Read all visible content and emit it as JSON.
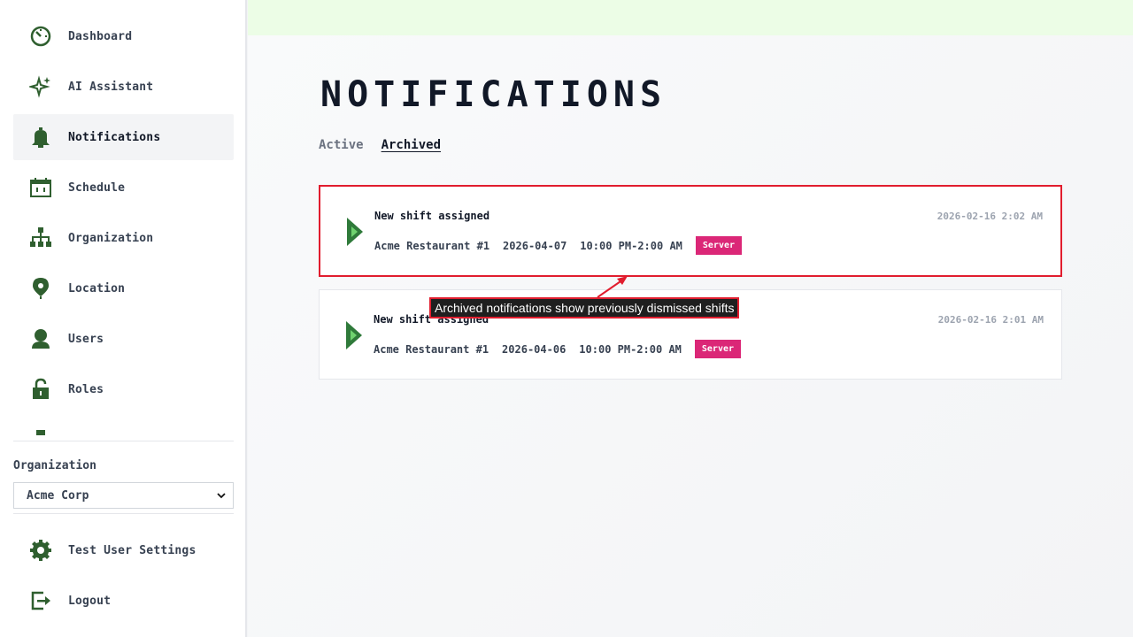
{
  "sidebar": {
    "items": [
      {
        "label": "Dashboard",
        "icon": "dashboard-icon"
      },
      {
        "label": "AI Assistant",
        "icon": "sparkle-icon"
      },
      {
        "label": "Notifications",
        "icon": "bell-icon",
        "active": true
      },
      {
        "label": "Schedule",
        "icon": "calendar-icon"
      },
      {
        "label": "Organization",
        "icon": "org-chart-icon"
      },
      {
        "label": "Location",
        "icon": "map-pin-icon"
      },
      {
        "label": "Users",
        "icon": "user-icon"
      },
      {
        "label": "Roles",
        "icon": "lock-icon"
      }
    ],
    "organization_label": "Organization",
    "organization_selected": "Acme Corp",
    "bottom_items": [
      {
        "label": "Test User Settings",
        "icon": "gear-icon"
      },
      {
        "label": "Logout",
        "icon": "logout-icon"
      }
    ]
  },
  "main": {
    "title": "NOTIFICATIONS",
    "tabs": [
      {
        "label": "Active",
        "selected": false
      },
      {
        "label": "Archived",
        "selected": true
      }
    ],
    "notifications": [
      {
        "title": "New shift assigned",
        "location": "Acme Restaurant #1",
        "date": "2026-04-07",
        "time_range": "10:00 PM-2:00 AM",
        "role": "Server",
        "timestamp": "2026-02-16 2:02 AM"
      },
      {
        "title": "New shift assigned",
        "location": "Acme Restaurant #1",
        "date": "2026-04-06",
        "time_range": "10:00 PM-2:00 AM",
        "role": "Server",
        "timestamp": "2026-02-16 2:01 AM"
      }
    ]
  },
  "annotation": {
    "text": "Archived notifications show previously dismissed shifts"
  },
  "colors": {
    "icon_green": "#2f5f2f",
    "accent_green": "#5cb85c",
    "badge_pink": "#db2777",
    "highlight_red": "#e11d2e",
    "topbar_green": "#ecfde6"
  }
}
